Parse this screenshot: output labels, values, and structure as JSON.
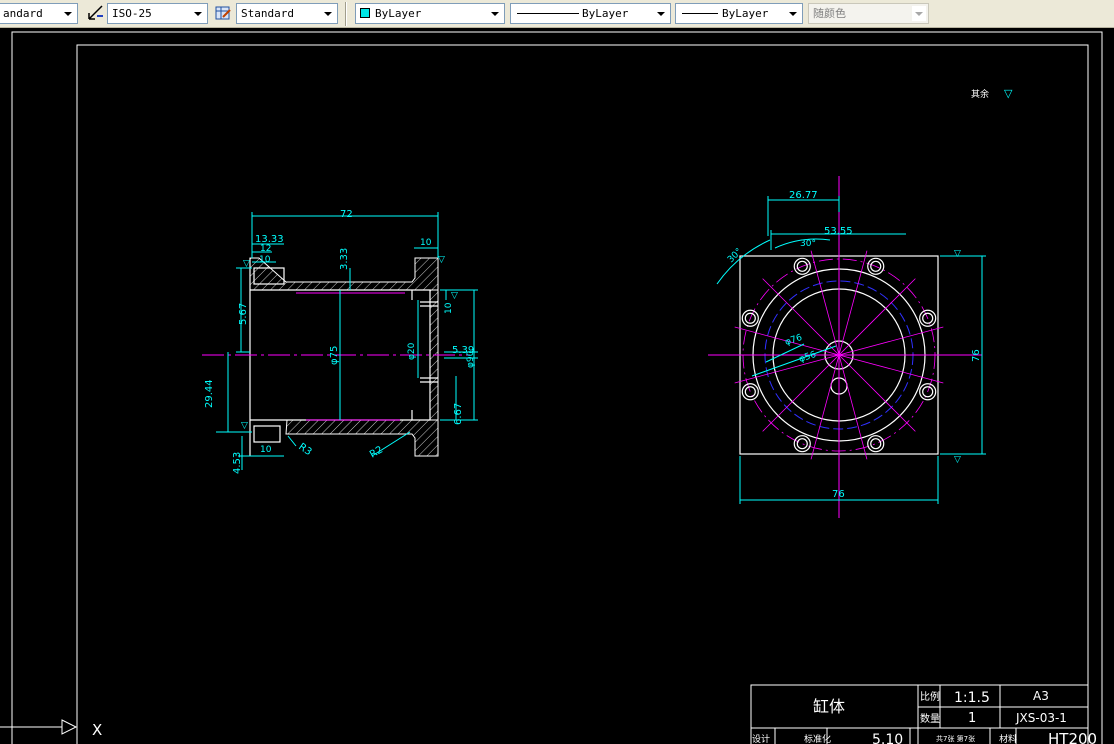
{
  "toolbar": {
    "text_style": "andard",
    "dim_style": "ISO-25",
    "table_style": "Standard",
    "layer_color": "ByLayer",
    "linetype": "ByLayer",
    "lineweight": "ByLayer",
    "plot_style": "随颜色"
  },
  "colors": {
    "background": "#000000",
    "geometry": "#ffffff",
    "dimension": "#00ffff",
    "centerline": "#ff00ff",
    "hidden": "#3030ff"
  },
  "drawing": {
    "roughness_note": "其余",
    "roughness_symbol": "▽",
    "ucs_x_label": "X",
    "section_view": {
      "dims": {
        "overall_length": "72",
        "d_13_33": "13.33",
        "d_12": "12",
        "d_10_top": "10",
        "d_10_flange": "10",
        "d_3_33": "3.33",
        "d_5_67": "5.67",
        "d_29_44": "29.44",
        "d_4_53": "4.53",
        "d_10_bottom": "10",
        "dia_75": "φ75",
        "dia_20": "φ20",
        "d_5_39": "5.39",
        "dia_90": "φ90",
        "d_6_67": "6.67",
        "d_10_right": "10",
        "r3": "R3",
        "r2": "R2"
      }
    },
    "end_view": {
      "dims": {
        "d_26_77": "26.77",
        "d_53_55": "53.55",
        "angle_30_a": "30°",
        "angle_30_b": "30°",
        "dia_76": "φ76",
        "dia_56": "φ56",
        "height_76": "76",
        "width_76": "76"
      }
    },
    "title_block": {
      "part_name": "缸体",
      "scale_label": "比例",
      "scale_value": "1:1.5",
      "sheet_size": "A3",
      "qty_label": "数量",
      "qty_value": "1",
      "drawing_no": "JXS-03-1",
      "designer_label": "设计",
      "standard_label": "标准化",
      "date_value": "5.10",
      "sheets_label": "共7张 第7张",
      "material_label": "材料",
      "material_value": "HT200"
    }
  }
}
